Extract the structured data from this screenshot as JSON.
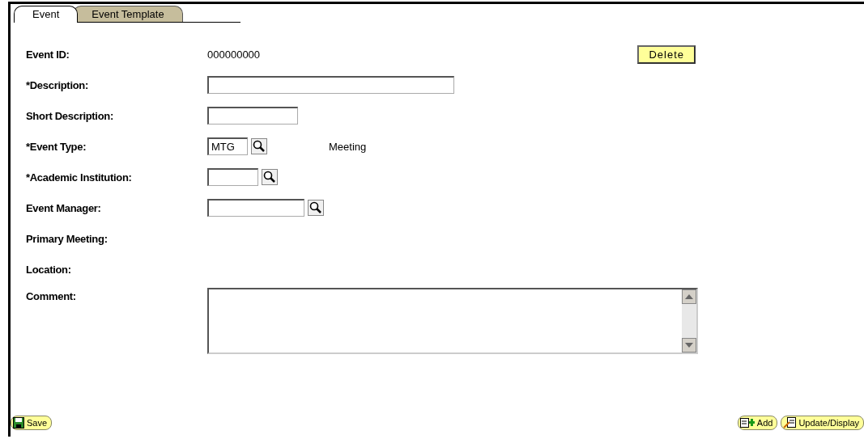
{
  "tabs": [
    {
      "label": "Event",
      "selected": true
    },
    {
      "label": "Event Template",
      "selected": false
    }
  ],
  "rows": [
    {
      "label": "Event ID:",
      "kind": "readonly",
      "value": "000000000"
    },
    {
      "label": "*Description:",
      "kind": "text",
      "value": ""
    },
    {
      "label": "Short Description:",
      "kind": "text",
      "value": ""
    },
    {
      "label": "*Event Type:",
      "kind": "lookup",
      "value": "MTG",
      "description": "Meeting"
    },
    {
      "label": "*Academic Institution:",
      "kind": "lookup",
      "value": ""
    },
    {
      "label": "Event Manager:",
      "kind": "lookup",
      "value": ""
    },
    {
      "label": "Primary Meeting:",
      "kind": "label"
    },
    {
      "label": "Location:",
      "kind": "label"
    },
    {
      "label": "Comment:",
      "kind": "textarea",
      "value": ""
    }
  ],
  "delete_button": "Delete",
  "footer": {
    "save": "Save",
    "add": "Add",
    "update": "Update/Display"
  }
}
